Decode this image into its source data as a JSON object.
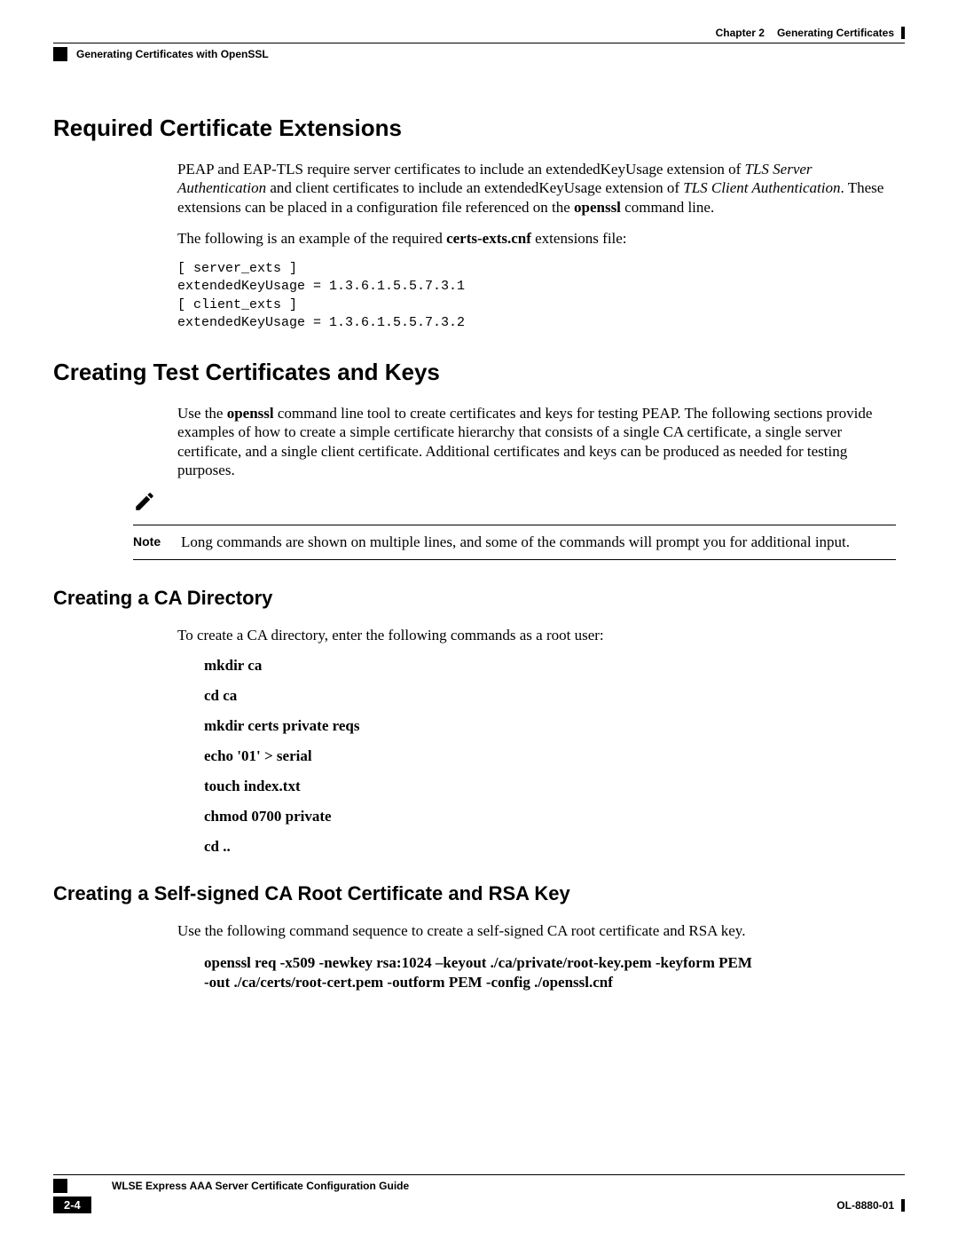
{
  "header": {
    "chapter": "Chapter 2",
    "title": "Generating Certificates",
    "subtitle": "Generating Certificates with OpenSSL"
  },
  "section1": {
    "heading": "Required Certificate Extensions",
    "p1_a": "PEAP and EAP-TLS require server certificates to include an extendedKeyUsage extension of ",
    "p1_i1": "TLS Server Authentication",
    "p1_b": " and client certificates to include an extendedKeyUsage extension of ",
    "p1_i2": "TLS Client Authentication",
    "p1_c": ". These extensions can be placed in a configuration file referenced on the ",
    "p1_bold": "openssl",
    "p1_d": " command line.",
    "p2_a": "The following is an example of the required ",
    "p2_bold": "certs-exts.cnf",
    "p2_b": " extensions file:",
    "code": "[ server_exts ]\nextendedKeyUsage = 1.3.6.1.5.5.7.3.1\n[ client_exts ]\nextendedKeyUsage = 1.3.6.1.5.5.7.3.2"
  },
  "section2": {
    "heading": "Creating Test Certificates and Keys",
    "p1_a": "Use the ",
    "p1_bold": "openssl",
    "p1_b": " command line tool to create certificates and keys for testing PEAP. The following sections provide examples of how to create a simple certificate hierarchy that consists of a single CA certificate, a single server certificate, and a single client certificate. Additional certificates and keys can be produced as needed for testing purposes.",
    "note_label": "Note",
    "note_text": "Long commands are shown on multiple lines, and some of the commands will prompt you for additional input."
  },
  "section3": {
    "heading": "Creating a CA Directory",
    "p1": "To create a CA directory, enter the following commands as a root user:",
    "cmds": {
      "c1": "mkdir ca",
      "c2": "cd ca",
      "c3": "mkdir certs private reqs",
      "c4": "echo '01' > serial",
      "c5": "touch index.txt",
      "c6": "chmod 0700 private",
      "c7": "cd .."
    }
  },
  "section4": {
    "heading": "Creating a Self-signed CA Root Certificate and RSA Key",
    "p1": "Use the following command sequence to create a self-signed CA root certificate and RSA key.",
    "cmd_line1": "openssl req -x509 -newkey rsa:1024 –keyout ./ca/private/root-key.pem -keyform PEM",
    "cmd_line2": "-out ./ca/certs/root-cert.pem -outform PEM -config ./openssl.cnf"
  },
  "footer": {
    "guide": "WLSE Express AAA Server Certificate Configuration Guide",
    "page": "2-4",
    "doc": "OL-8880-01"
  }
}
